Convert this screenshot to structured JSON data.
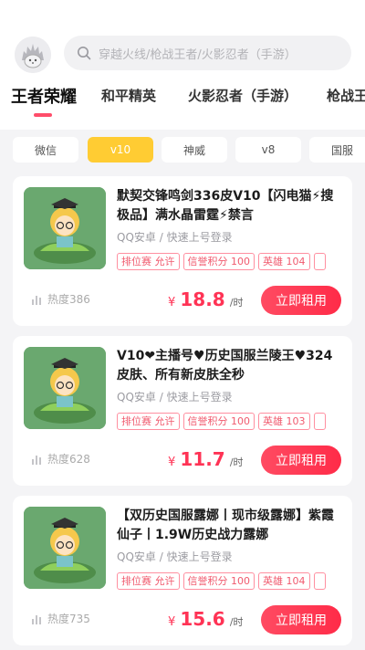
{
  "search": {
    "placeholder": "穿越火线/枪战王者/火影忍者（手游）"
  },
  "tabs": [
    "王者荣耀",
    "和平精英",
    "火影忍者（手游）",
    "枪战王者"
  ],
  "chips": [
    "微信",
    "v10",
    "神威",
    "v8",
    "国服"
  ],
  "accent": "#ff4d6a",
  "chip_active_color": "#ffcc33",
  "listings": [
    {
      "title": "默契交锋鸣剑336皮V10【闪电猫⚡搜极品】满水晶雷霆⚡禁言",
      "login": "QQ安卓 / 快速上号登录",
      "tags": [
        "排位赛 允许",
        "信誉积分 100",
        "英雄 104"
      ],
      "heat": "热度386",
      "currency": "¥",
      "price": "18.8",
      "unit": "/时",
      "button": "立即租用"
    },
    {
      "title": "V10❤主播号♥历史国服兰陵王♥324皮肤、所有新皮肤全秒",
      "login": "QQ安卓 / 快速上号登录",
      "tags": [
        "排位赛 允许",
        "信誉积分 100",
        "英雄 103"
      ],
      "heat": "热度628",
      "currency": "¥",
      "price": "11.7",
      "unit": "/时",
      "button": "立即租用"
    },
    {
      "title": "【双历史国服露娜丨现市级露娜】紫霞仙子丨1.9W历史战力露娜",
      "login": "QQ安卓 / 快速上号登录",
      "tags": [
        "排位赛 允许",
        "信誉积分 100",
        "英雄 104"
      ],
      "heat": "热度735",
      "currency": "¥",
      "price": "15.6",
      "unit": "/时",
      "button": "立即租用"
    }
  ]
}
